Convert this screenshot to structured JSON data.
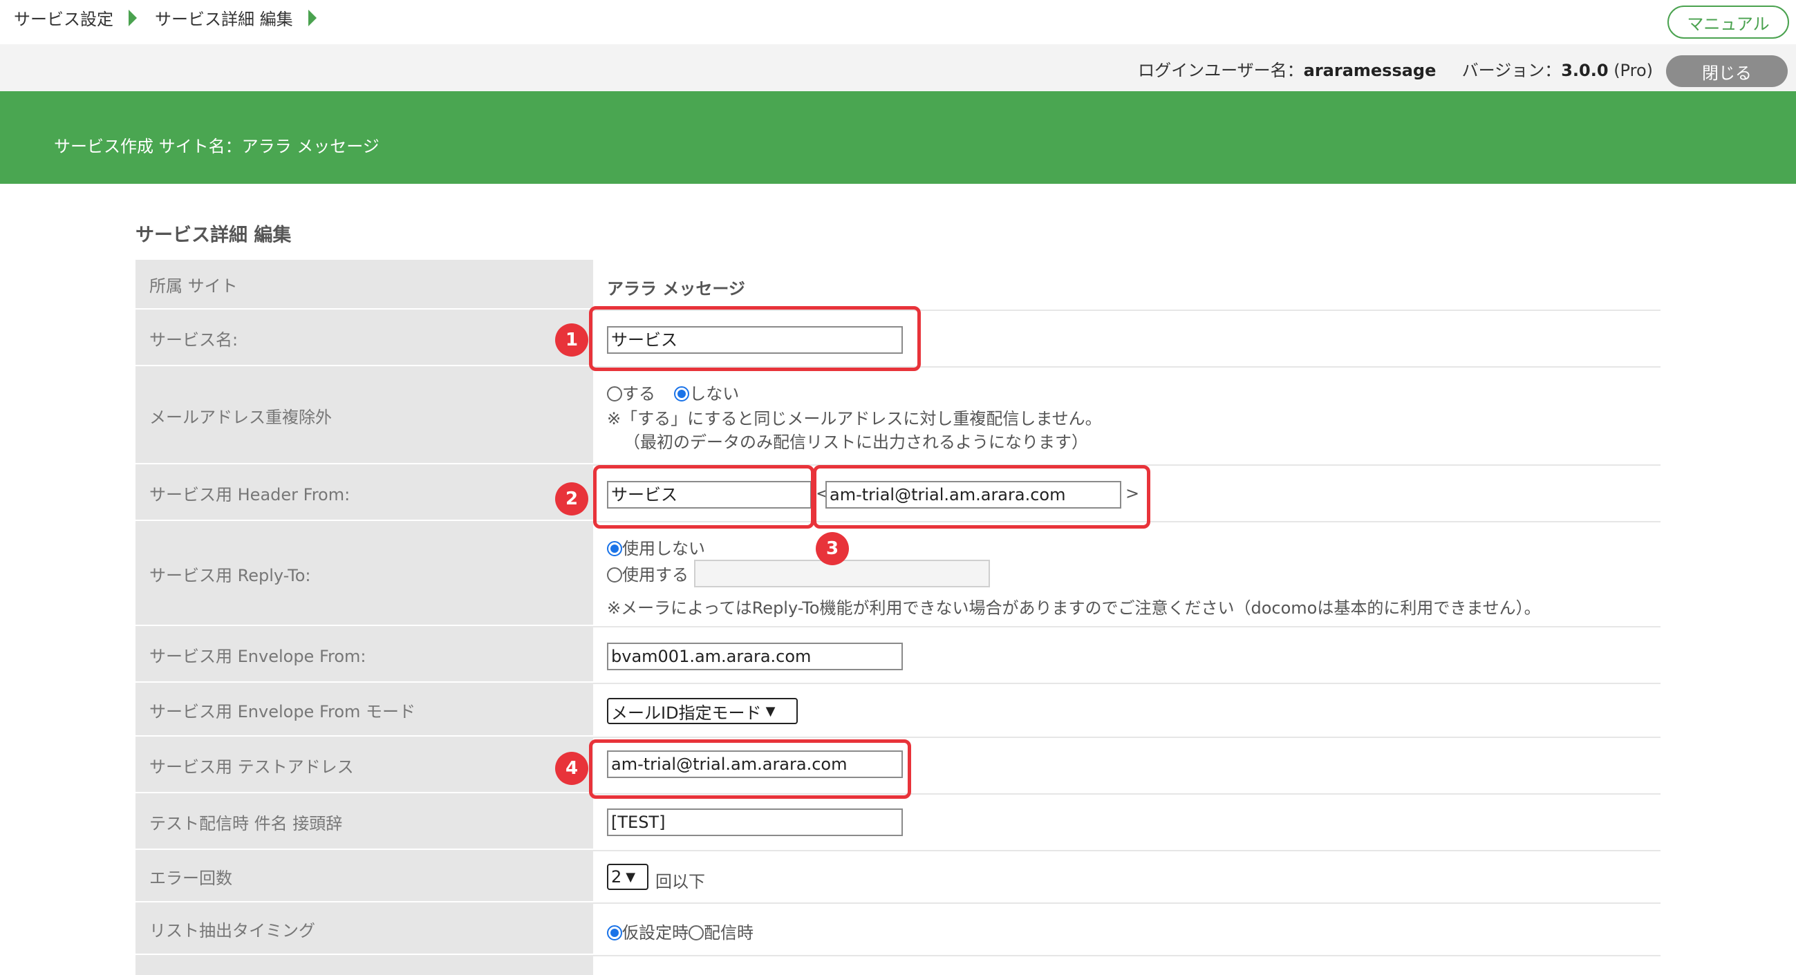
{
  "breadcrumb": {
    "items": [
      "サービス設定",
      "サービス詳細 編集"
    ]
  },
  "header": {
    "manual_label": "マニュアル",
    "login_label": "ログインユーザー名：",
    "login_user": "araramessage",
    "version_label": "バージョン：",
    "version_value": "3.0.0",
    "version_edition": "(Pro)",
    "close_label": "閉じる"
  },
  "banner": {
    "title": "サービス作成 サイト名：アララ メッセージ"
  },
  "section": {
    "title": "サービス詳細 編集"
  },
  "form": {
    "site": {
      "label": "所属 サイト",
      "value": "アララ メッセージ"
    },
    "service_name": {
      "label": "サービス名:",
      "value": "サービス"
    },
    "dup_exclude": {
      "label": "メールアドレス重複除外",
      "option_yes": "する",
      "option_no": "しない",
      "note1": "※「する」にすると同じメールアドレスに対し重複配信しません。",
      "note2": "（最初のデータのみ配信リストに出力されるようになります）"
    },
    "header_from": {
      "label": "サービス用 Header From:",
      "name_value": "サービス",
      "open_bracket": "<",
      "email_value": "am-trial@trial.am.arara.com",
      "close_bracket": ">"
    },
    "reply_to": {
      "label": "サービス用 Reply-To:",
      "option_off": "使用しない",
      "option_on": "使用する",
      "value": "",
      "note": "※メーラによってはReply-To機能が利用できない場合がありますのでご注意ください（docomoは基本的に利用できません）。"
    },
    "envelope_from": {
      "label": "サービス用 Envelope From:",
      "value": "bvam001.am.arara.com"
    },
    "envelope_mode": {
      "label": "サービス用 Envelope From モード",
      "selected": "メールID指定モード"
    },
    "test_address": {
      "label": "サービス用 テストアドレス",
      "value": "am-trial@trial.am.arara.com"
    },
    "test_prefix": {
      "label": "テスト配信時 件名 接頭辞",
      "value": "[TEST]"
    },
    "error_count": {
      "label": "エラー回数",
      "selected": "2",
      "suffix": "回以下"
    },
    "list_timing": {
      "label": "リスト抽出タイミング",
      "option_a": "仮設定時",
      "option_b": "配信時"
    }
  },
  "annotations": {
    "badge1": "1",
    "badge2": "2",
    "badge3": "3",
    "badge4": "4"
  },
  "colors": {
    "accent_green": "#4aa651",
    "annotation_red": "#e8333a",
    "label_bg": "#e6e6e6",
    "radio_blue": "#1a73e8"
  },
  "icons": {
    "breadcrumb_separator": "triangle-right-icon",
    "select_caret": "chevron-down-icon"
  }
}
